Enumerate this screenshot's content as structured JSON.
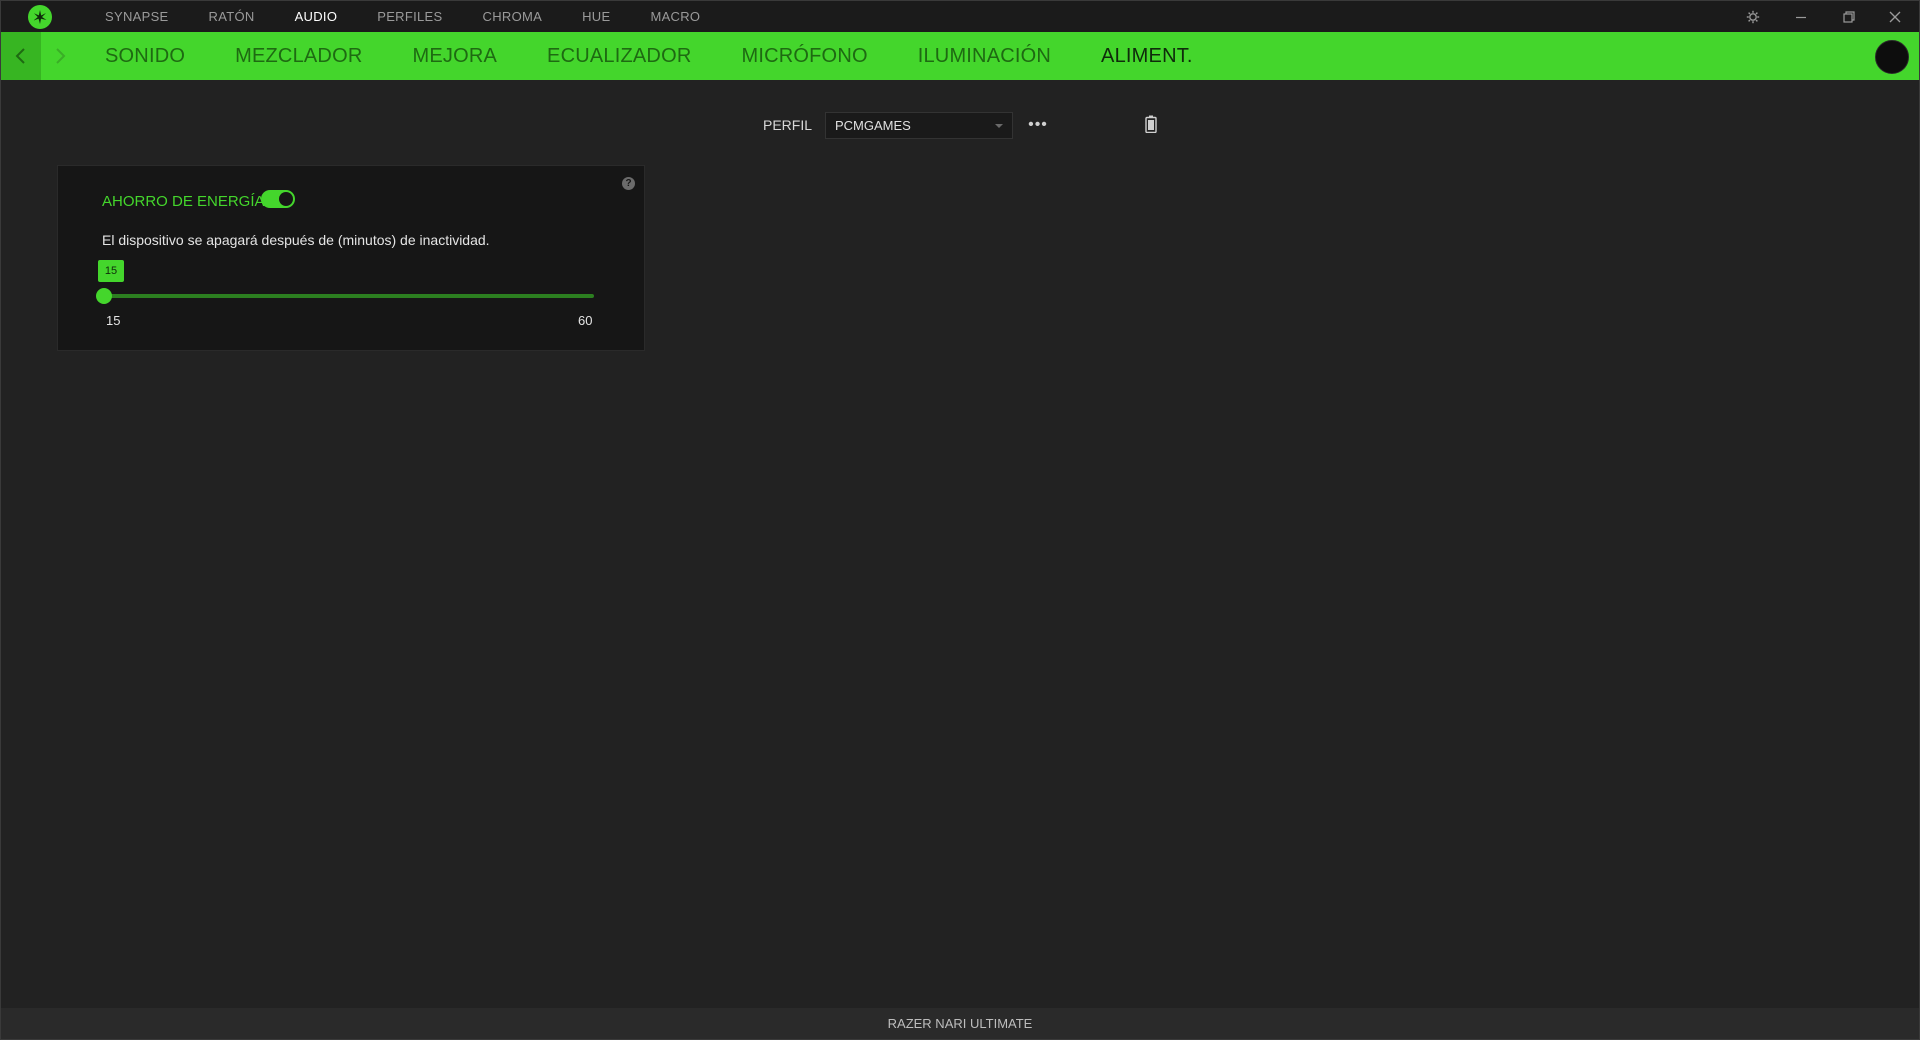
{
  "topnav": {
    "items": [
      {
        "label": "SYNAPSE",
        "active": false
      },
      {
        "label": "RATÓN",
        "active": false
      },
      {
        "label": "AUDIO",
        "active": true
      },
      {
        "label": "PERFILES",
        "active": false
      },
      {
        "label": "CHROMA",
        "active": false
      },
      {
        "label": "HUE",
        "active": false
      },
      {
        "label": "MACRO",
        "active": false
      }
    ]
  },
  "subnav": {
    "tabs": [
      {
        "label": "SONIDO",
        "active": false
      },
      {
        "label": "MEZCLADOR",
        "active": false
      },
      {
        "label": "MEJORA",
        "active": false
      },
      {
        "label": "ECUALIZADOR",
        "active": false
      },
      {
        "label": "MICRÓFONO",
        "active": false
      },
      {
        "label": "ILUMINACIÓN",
        "active": false
      },
      {
        "label": "ALIMENT.",
        "active": true
      }
    ]
  },
  "profile": {
    "label": "PERFIL",
    "selected": "PCMGAMES",
    "more_label": "•••"
  },
  "power_saving": {
    "title": "AHORRO DE ENERGÍA",
    "enabled": true,
    "help_label": "?",
    "description": "El dispositivo se apagará después de (minutos) de inactividad.",
    "slider": {
      "value": "15",
      "min": "15",
      "max": "60"
    }
  },
  "footer": {
    "device_name": "RAZER NARI ULTIMATE"
  },
  "colors": {
    "accent": "#44d62c",
    "background": "#222222",
    "card": "#161616"
  }
}
